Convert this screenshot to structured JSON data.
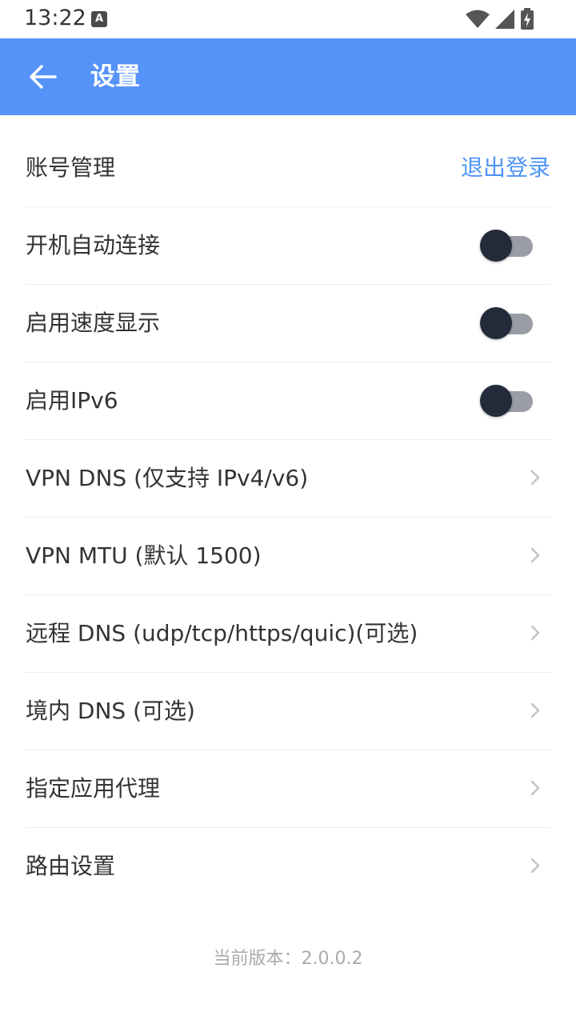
{
  "status_bar": {
    "time": "13:22",
    "notification_icon": "A",
    "icons": [
      "wifi-icon",
      "cell-signal-icon",
      "battery-charging-icon"
    ]
  },
  "app_bar": {
    "title": "设置",
    "color": "#5593f9"
  },
  "settings": {
    "account": {
      "label": "账号管理",
      "action": "退出登录"
    },
    "toggles": [
      {
        "label": "开机自动连接",
        "enabled": false
      },
      {
        "label": "启用速度显示",
        "enabled": false
      },
      {
        "label": "启用IPv6",
        "enabled": false
      }
    ],
    "links": [
      {
        "label": "VPN DNS (仅支持 IPv4/v6)"
      },
      {
        "label": "VPN MTU (默认 1500)"
      },
      {
        "label": "远程 DNS (udp/tcp/https/quic)(可选)"
      },
      {
        "label": "境内 DNS (可选)"
      },
      {
        "label": "指定应用代理"
      },
      {
        "label": "路由设置"
      }
    ]
  },
  "footer": {
    "version": "当前版本：2.0.0.2"
  },
  "colors": {
    "accent": "#4f94f6",
    "toggle_knob": "#232a39",
    "toggle_track": "#9a9da6"
  }
}
